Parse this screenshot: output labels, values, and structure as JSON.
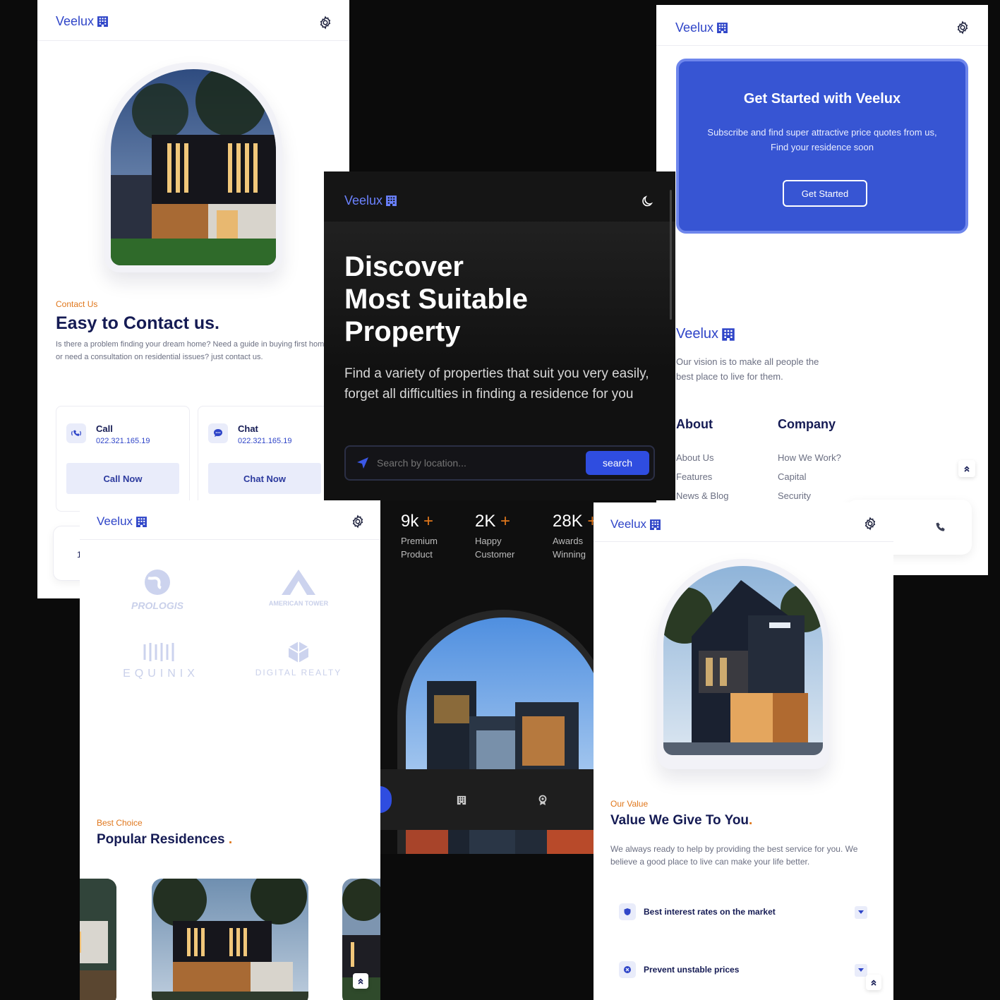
{
  "brand": {
    "name": "Veelux"
  },
  "contact": {
    "eyebrow": "Contact Us",
    "title": "Easy to Contact us.",
    "body": "Is there a problem finding your dream home? Need a guide in buying first home? or need a consultation on residential issues? just contact us.",
    "call": {
      "label": "Call",
      "number": "022.321.165.19",
      "button": "Call Now"
    },
    "chat": {
      "label": "Chat",
      "number": "022.321.165.19",
      "button": "Chat Now"
    },
    "stub_text": "1"
  },
  "cta": {
    "title": "Get Started with Veelux",
    "body": "Subscribe and find super attractive price quotes from us, Find your residence soon",
    "button": "Get Started"
  },
  "footer": {
    "vision": "Our vision is to make all people the best place to live for them.",
    "about": {
      "heading": "About",
      "links": [
        "About Us",
        "Features",
        "News & Blog"
      ]
    },
    "company": {
      "heading": "Company",
      "links": [
        "How We Work?",
        "Capital",
        "Security"
      ]
    }
  },
  "hero": {
    "title_lines": [
      "Discover",
      "Most Suitable",
      "Property"
    ],
    "subtitle": "Find a variety of properties that suit you very easily, forget all difficulties in finding a residence for you",
    "search_placeholder": "Search by location...",
    "search_button": "search",
    "stats": [
      {
        "value": "9k",
        "plus": "+",
        "label1": "Premium",
        "label2": "Product"
      },
      {
        "value": "2K",
        "plus": "+",
        "label1": "Happy",
        "label2": "Customer"
      },
      {
        "value": "28K",
        "plus": "+",
        "label1": "Awards",
        "label2": "Winning"
      }
    ]
  },
  "partners": {
    "logos": [
      "PROLOGIS",
      "AMERICAN TOWER",
      "EQUINIX",
      "DIGITAL REALTY"
    ]
  },
  "residences": {
    "eyebrow": "Best Choice",
    "title": "Popular Residences",
    "dot": "."
  },
  "value": {
    "eyebrow": "Our Value",
    "title": "Value We Give To You",
    "dot": ".",
    "body": "We always ready to help by providing the best service for you. We believe a good place to live can make your life better.",
    "items": [
      "Best interest rates on the market",
      "Prevent unstable prices"
    ]
  },
  "colors": {
    "accent": "#2f45c8",
    "orange": "#e0771c",
    "navy": "#151b54",
    "dark": "#121212"
  }
}
